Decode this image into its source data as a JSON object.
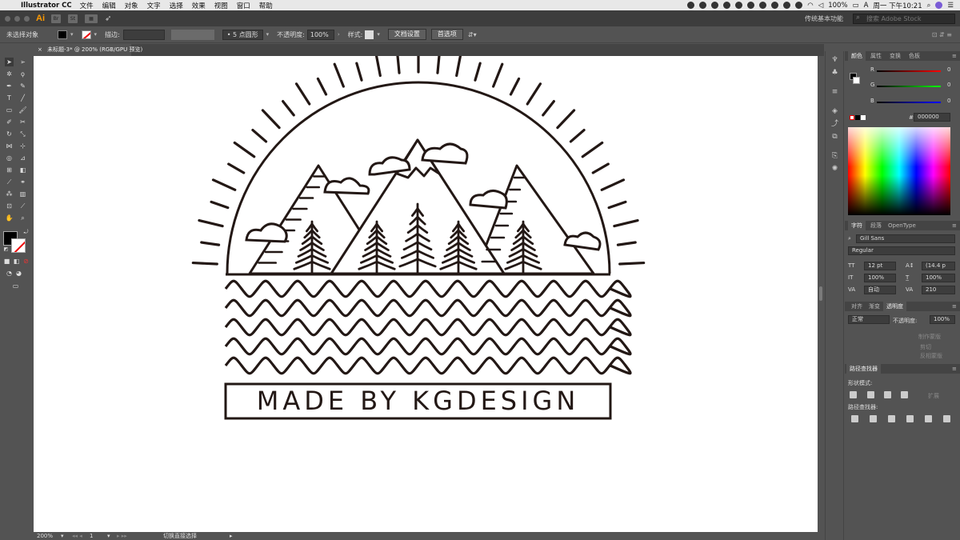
{
  "menubar": {
    "app_name": "Illustrator CC",
    "menus": [
      "文件",
      "编辑",
      "对象",
      "文字",
      "选择",
      "效果",
      "视图",
      "窗口",
      "帮助"
    ],
    "battery": "100%",
    "clock": "周一 下午10:21"
  },
  "appbar": {
    "logo": "Ai",
    "br": "Br",
    "st": "St",
    "workspace": "传统基本功能",
    "search_placeholder": "搜索 Adobe Stock"
  },
  "controlbar": {
    "selection_state": "未选择对象",
    "stroke_label": "描边:",
    "brush": "5 点圆形",
    "opacity_label": "不透明度:",
    "opacity_value": "100%",
    "style_label": "样式:",
    "doc_setup_button": "文档设置",
    "prefs_button": "首选项"
  },
  "document": {
    "tab_title": "未标题-3* @ 200% (RGB/GPU 预览)",
    "artwork_text": "MADE BY KGDESIGN"
  },
  "statusbar": {
    "zoom": "200%",
    "page": "1",
    "tool_status": "切换直接选择"
  },
  "panels": {
    "color_tabs": [
      "颜色",
      "属性",
      "变换",
      "色板"
    ],
    "rgb_labels": [
      "R",
      "G",
      "B"
    ],
    "rgb_values": [
      "0",
      "0",
      "0"
    ],
    "hex_value": "000000",
    "hex_label": "#",
    "char_tabs": [
      "字符",
      "段落",
      "OpenType"
    ],
    "font_family": "Gill Sans",
    "font_style": "Regular",
    "font_size": "12 pt",
    "leading": "(14.4 p",
    "vscale": "100%",
    "hscale": "100%",
    "kerning": "自动",
    "tracking": "210",
    "trans_tabs": [
      "对齐",
      "渐变",
      "透明度"
    ],
    "blend_mode": "正常",
    "trans_opacity_label": "不透明度:",
    "trans_opacity_value": "100%",
    "make_mask": "制作蒙版",
    "clip": "剪切",
    "invert_mask": "反相蒙版",
    "pathfinder_title": "路径查找器",
    "shape_modes_label": "形状模式:",
    "expand_button": "扩展",
    "pathfinders_label": "路径查找器:"
  }
}
